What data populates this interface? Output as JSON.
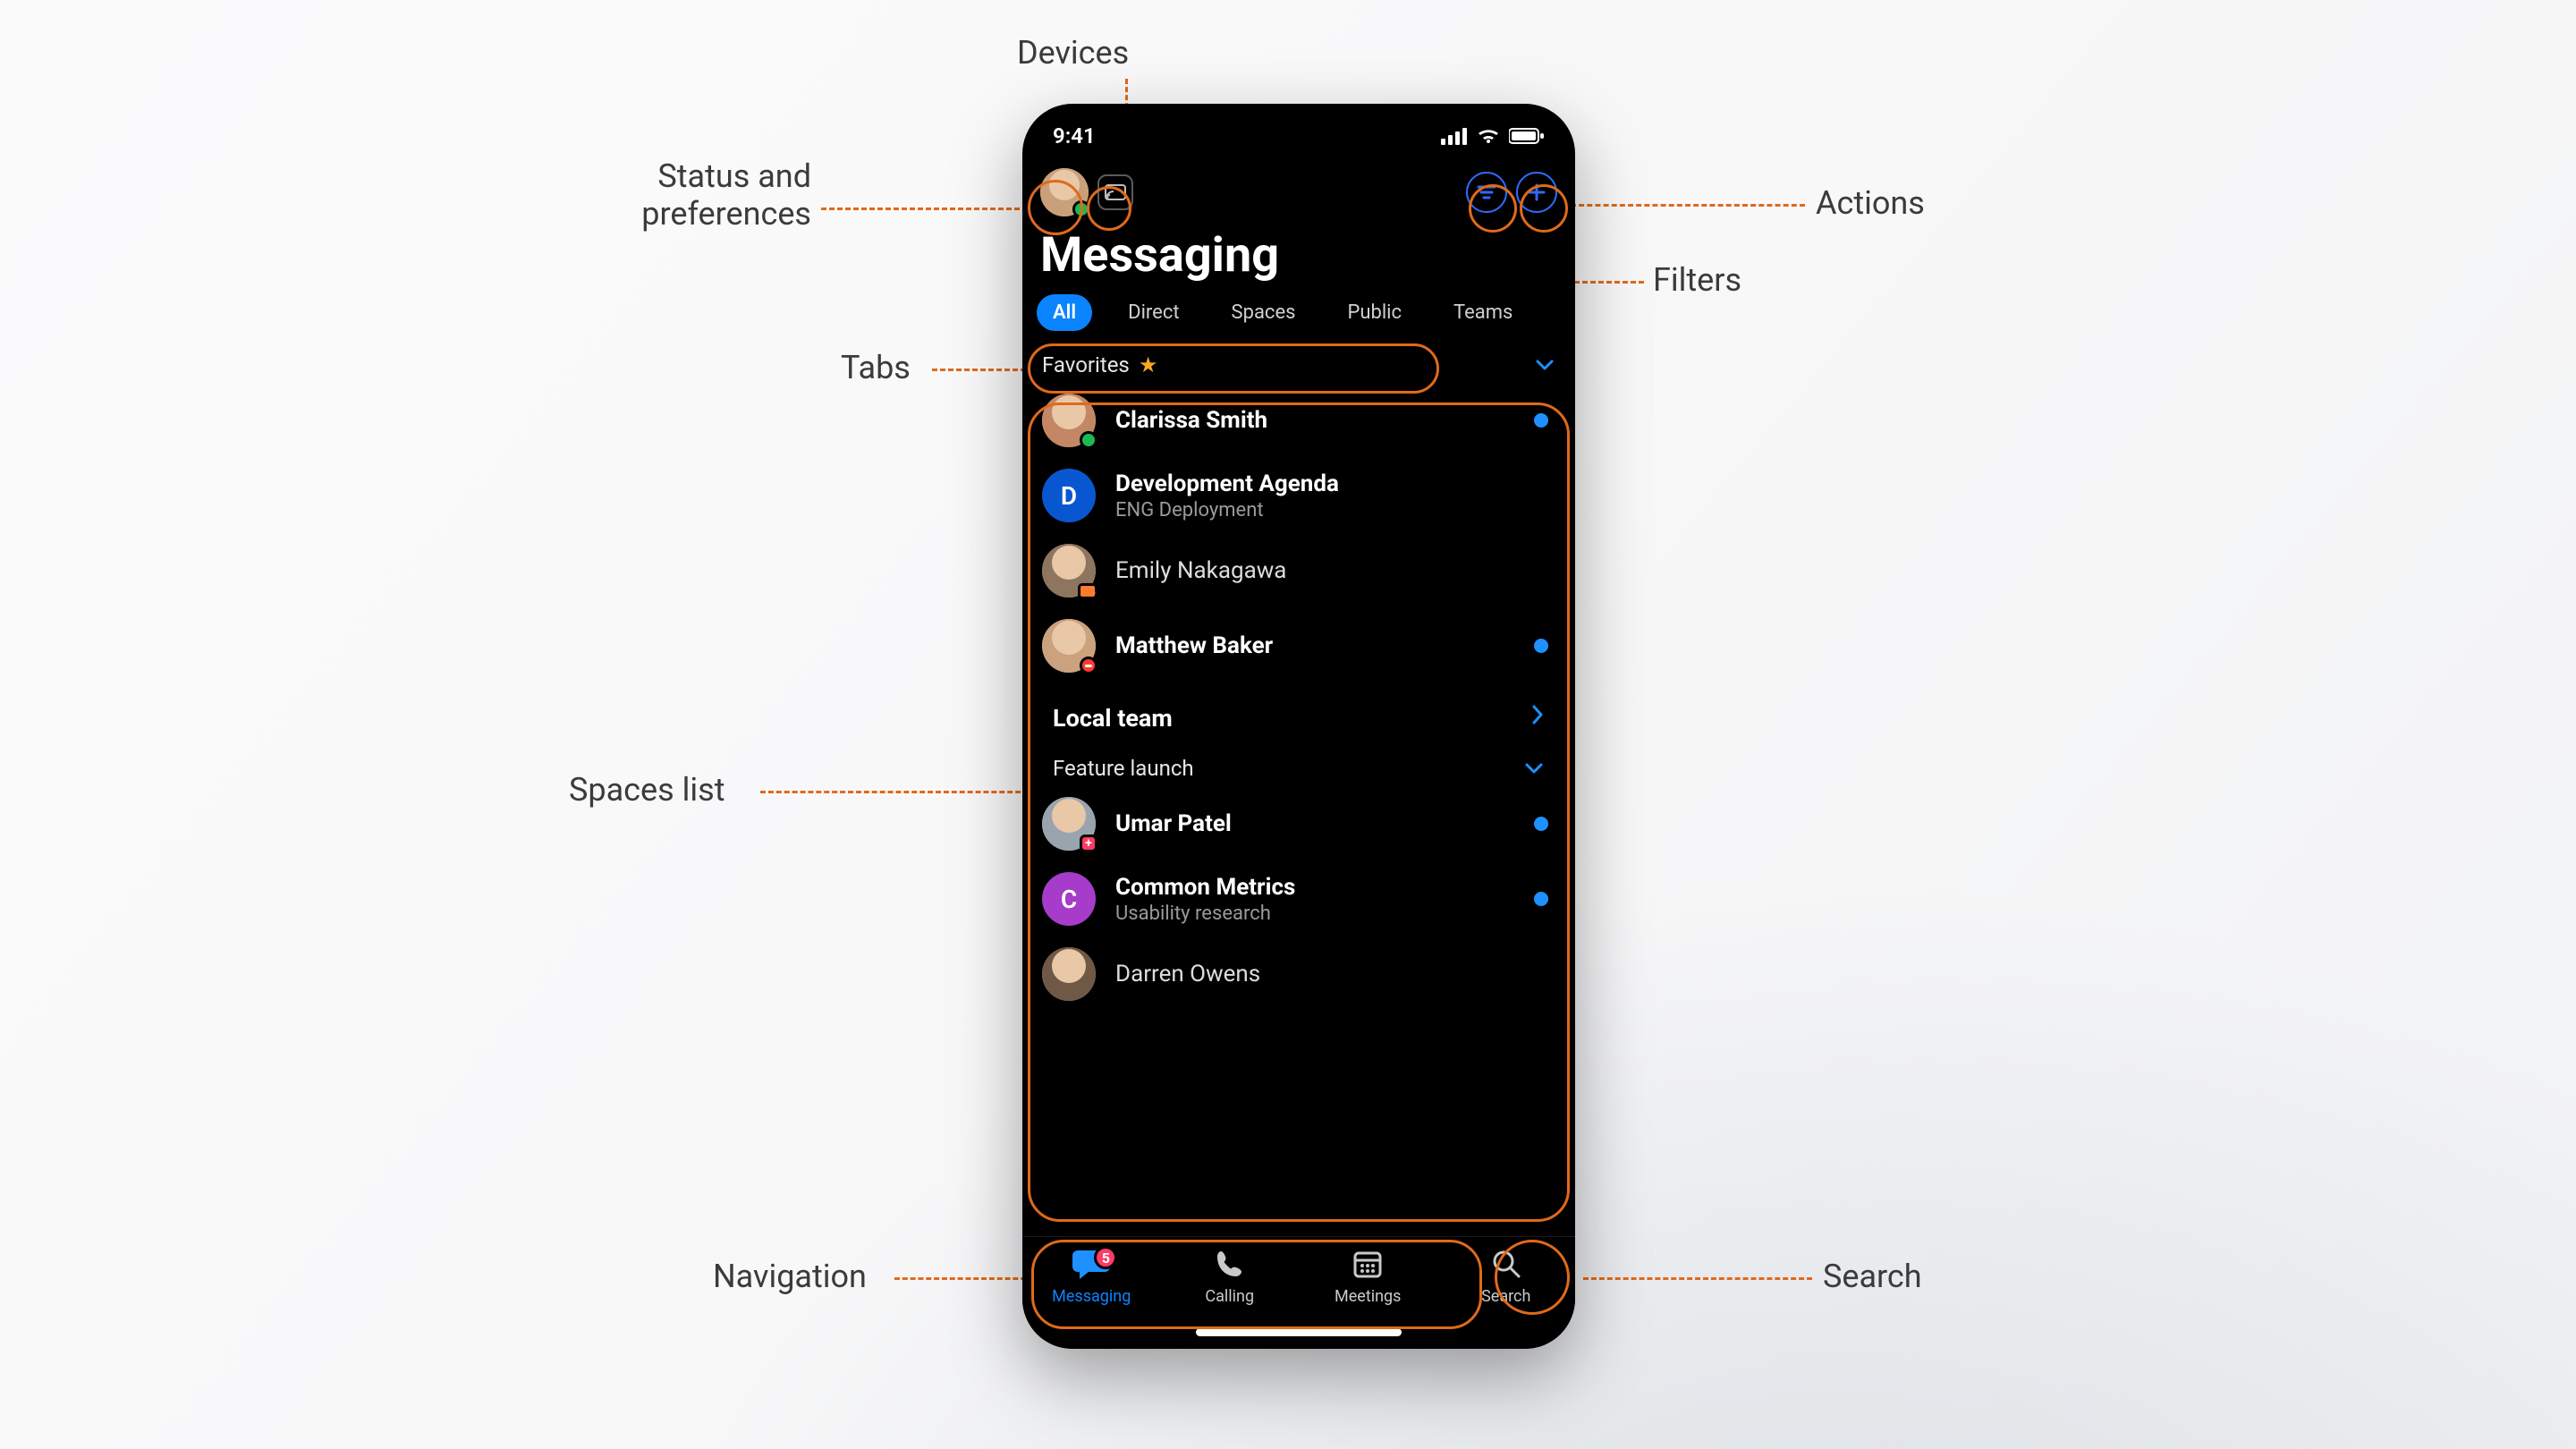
{
  "annotations": {
    "devices": "Devices",
    "status_prefs_line1": "Status and",
    "status_prefs_line2": "preferences",
    "actions": "Actions",
    "filters": "Filters",
    "tabs": "Tabs",
    "spaces_list": "Spaces list",
    "navigation": "Navigation",
    "search": "Search"
  },
  "statusbar": {
    "time": "9:41"
  },
  "page_title": "Messaging",
  "tabs": {
    "items": [
      "All",
      "Direct",
      "Spaces",
      "Public",
      "Teams"
    ],
    "active_index": 0
  },
  "sections": {
    "favorites": {
      "label": "Favorites"
    },
    "local_team": {
      "label": "Local team"
    },
    "feature_launch": {
      "label": "Feature launch"
    }
  },
  "rows": [
    {
      "name": "Clarissa Smith",
      "bold": true,
      "unread": true,
      "presence": "green",
      "avatar_bg": "#c38766"
    },
    {
      "name": "Development Agenda",
      "sub": "ENG Deployment",
      "bold": true,
      "initial": "D",
      "initial_bg": "#0957d0"
    },
    {
      "name": "Emily Nakagawa",
      "bold": false,
      "presence": "cam",
      "avatar_bg": "#8e7560"
    },
    {
      "name": "Matthew Baker",
      "bold": true,
      "unread": true,
      "presence": "dnd",
      "avatar_bg": "#caa27d"
    },
    {
      "name": "Umar Patel",
      "bold": true,
      "unread": true,
      "presence": "pink",
      "avatar_bg": "#9aa4ae"
    },
    {
      "name": "Common Metrics",
      "sub": "Usability research",
      "bold": true,
      "unread": true,
      "initial": "C",
      "initial_bg": "#a63cc9"
    },
    {
      "name": "Darren Owens",
      "bold": false,
      "avatar_bg": "#6f5846"
    }
  ],
  "nav": {
    "items": [
      {
        "label": "Messaging",
        "icon": "chat",
        "active": true,
        "badge": "5"
      },
      {
        "label": "Calling",
        "icon": "phone"
      },
      {
        "label": "Meetings",
        "icon": "calendar"
      },
      {
        "label": "Search",
        "icon": "search"
      }
    ]
  }
}
